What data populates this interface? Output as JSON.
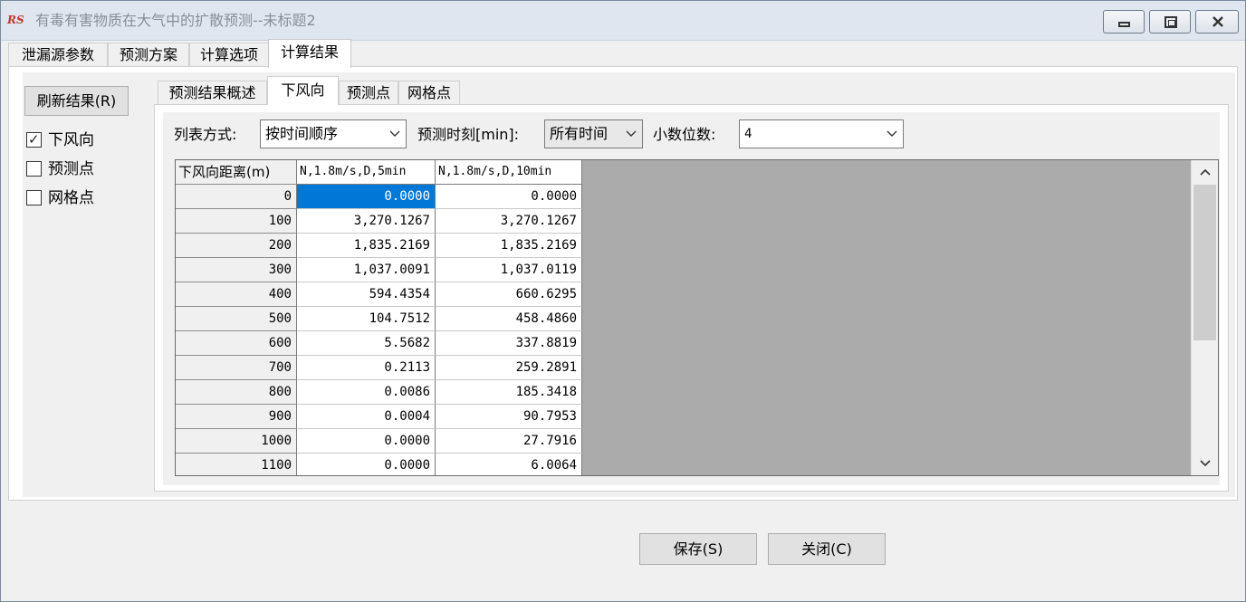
{
  "window": {
    "logo": "RS",
    "title": "有毒有害物质在大气中的扩散预测--未标题2"
  },
  "main_tabs": [
    "泄漏源参数",
    "预测方案",
    "计算选项",
    "计算结果"
  ],
  "left": {
    "refresh_label": "刷新结果(R)",
    "checkboxes": [
      {
        "label": "下风向",
        "checked": true
      },
      {
        "label": "预测点",
        "checked": false
      },
      {
        "label": "网格点",
        "checked": false
      }
    ]
  },
  "sub_tabs": [
    "预测结果概述",
    "下风向",
    "预测点",
    "网格点"
  ],
  "filters": {
    "list_mode_label": "列表方式:",
    "list_mode_value": "按时间顺序",
    "time_label": "预测时刻[min]:",
    "time_value": "所有时间",
    "decimals_label": "小数位数:",
    "decimals_value": "4"
  },
  "table": {
    "headers": [
      "下风向距离(m)",
      "N,1.8m/s,D,5min",
      "N,1.8m/s,D,10min"
    ],
    "rows": [
      [
        "0",
        "0.0000",
        "0.0000"
      ],
      [
        "100",
        "3,270.1267",
        "3,270.1267"
      ],
      [
        "200",
        "1,835.2169",
        "1,835.2169"
      ],
      [
        "300",
        "1,037.0091",
        "1,037.0119"
      ],
      [
        "400",
        "594.4354",
        "660.6295"
      ],
      [
        "500",
        "104.7512",
        "458.4860"
      ],
      [
        "600",
        "5.5682",
        "337.8819"
      ],
      [
        "700",
        "0.2113",
        "259.2891"
      ],
      [
        "800",
        "0.0086",
        "185.3418"
      ],
      [
        "900",
        "0.0004",
        "90.7953"
      ],
      [
        "1000",
        "0.0000",
        "27.7916"
      ],
      [
        "1100",
        "0.0000",
        "6.0064"
      ]
    ]
  },
  "buttons": {
    "save": "保存(S)",
    "close": "关闭(C)"
  },
  "colors": {
    "selection": "#0078d7",
    "grid_background": "#ababab",
    "logo": "#c0392b"
  }
}
